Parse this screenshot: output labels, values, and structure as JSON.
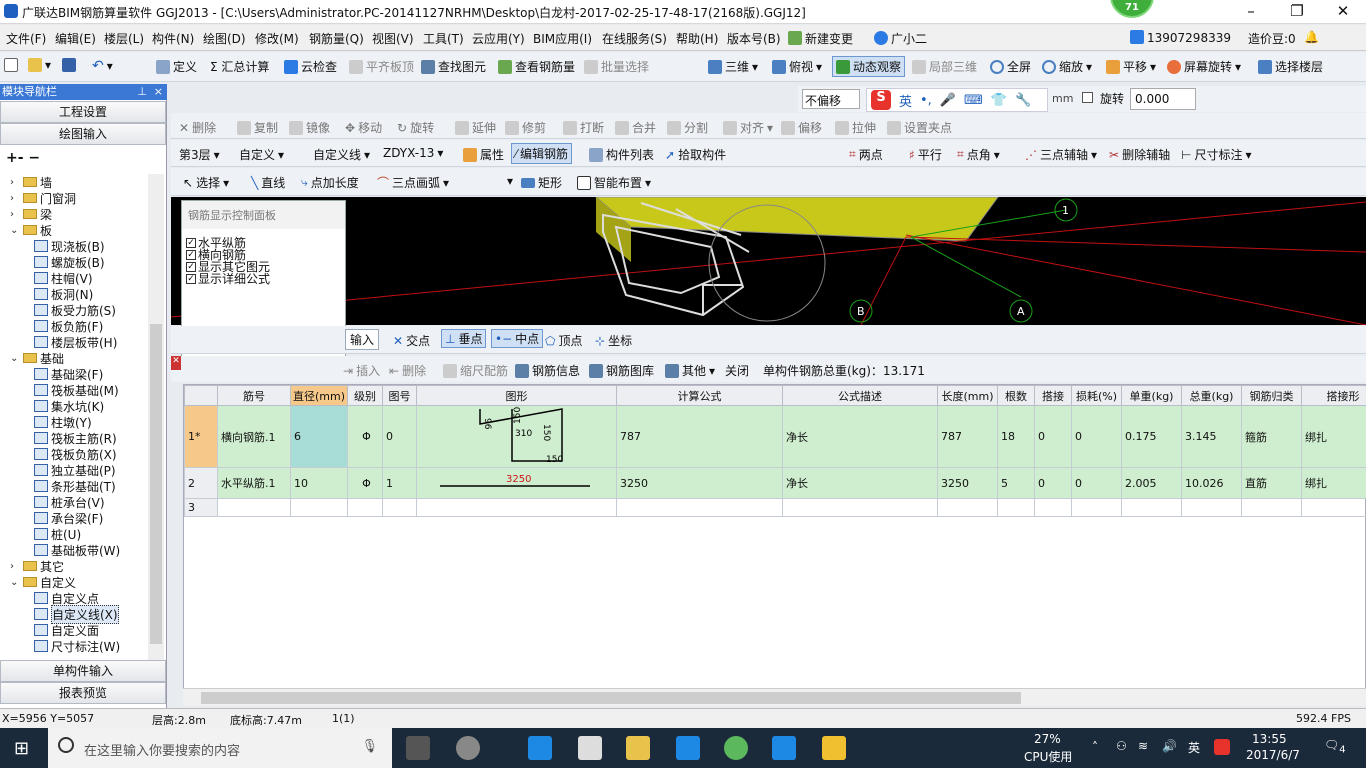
{
  "app": {
    "title": "广联达BIM钢筋算量软件 GGJ2013 - [C:\\Users\\Administrator.PC-20141127NRHM\\Desktop\\白龙村-2017-02-25-17-48-17(2168版).GGJ12]",
    "badge": "71"
  },
  "menu": [
    "文件(F)",
    "编辑(E)",
    "楼层(L)",
    "构件(N)",
    "绘图(D)",
    "修改(M)",
    "钢筋量(Q)",
    "视图(V)",
    "工具(T)",
    "云应用(Y)",
    "BIM应用(I)",
    "在线服务(S)",
    "帮助(H)",
    "版本号(B)",
    "新建变更",
    "广小二"
  ],
  "menu_right": {
    "phone": "13907298339",
    "price": "造价豆:0"
  },
  "toolbar1": [
    "定义",
    "Σ 汇总计算",
    "云检查",
    "平齐板顶",
    "查找图元",
    "查看钢筋量",
    "批量选择",
    "三维",
    "俯视",
    "动态观察",
    "局部三维",
    "全屏",
    "缩放",
    "平移",
    "屏幕旋转",
    "选择楼层"
  ],
  "offset": {
    "mode": "不偏移",
    "unit": "mm",
    "rotate_label": "旋转",
    "rotate_value": "0.000"
  },
  "toolbar2": [
    "删除",
    "复制",
    "镜像",
    "移动",
    "旋转",
    "延伸",
    "修剪",
    "打断",
    "合并",
    "分割",
    "对齐",
    "偏移",
    "拉伸",
    "设置夹点"
  ],
  "toolbar3": {
    "floor": "第3层",
    "type": "自定义",
    "sub": "自定义线",
    "code": "ZDYX-13",
    "items": [
      "属性",
      "编辑钢筋",
      "构件列表",
      "拾取构件",
      "两点",
      "平行",
      "点角",
      "三点辅轴",
      "删除辅轴",
      "尺寸标注"
    ]
  },
  "toolbar4": [
    "选择",
    "直线",
    "点加长度",
    "三点画弧",
    "矩形",
    "智能布置"
  ],
  "nav": {
    "title": "模块导航栏",
    "btn_settings": "工程设置",
    "btn_draw": "绘图输入",
    "btn_single": "单构件输入",
    "btn_report": "报表预览",
    "tree": [
      {
        "label": "墙",
        "level": 0,
        "kind": "folder",
        "state": "collapsed"
      },
      {
        "label": "门窗洞",
        "level": 0,
        "kind": "folder",
        "state": "collapsed"
      },
      {
        "label": "梁",
        "level": 0,
        "kind": "folder",
        "state": "collapsed"
      },
      {
        "label": "板",
        "level": 0,
        "kind": "folder",
        "state": "expanded"
      },
      {
        "label": "现浇板(B)",
        "level": 1
      },
      {
        "label": "螺旋板(B)",
        "level": 1
      },
      {
        "label": "柱帽(V)",
        "level": 1
      },
      {
        "label": "板洞(N)",
        "level": 1
      },
      {
        "label": "板受力筋(S)",
        "level": 1
      },
      {
        "label": "板负筋(F)",
        "level": 1
      },
      {
        "label": "楼层板带(H)",
        "level": 1
      },
      {
        "label": "基础",
        "level": 0,
        "kind": "folder",
        "state": "expanded"
      },
      {
        "label": "基础梁(F)",
        "level": 1
      },
      {
        "label": "筏板基础(M)",
        "level": 1
      },
      {
        "label": "集水坑(K)",
        "level": 1
      },
      {
        "label": "柱墩(Y)",
        "level": 1
      },
      {
        "label": "筏板主筋(R)",
        "level": 1
      },
      {
        "label": "筏板负筋(X)",
        "level": 1
      },
      {
        "label": "独立基础(P)",
        "level": 1
      },
      {
        "label": "条形基础(T)",
        "level": 1
      },
      {
        "label": "桩承台(V)",
        "level": 1
      },
      {
        "label": "承台梁(F)",
        "level": 1
      },
      {
        "label": "桩(U)",
        "level": 1
      },
      {
        "label": "基础板带(W)",
        "level": 1
      },
      {
        "label": "其它",
        "level": 0,
        "kind": "folder",
        "state": "collapsed"
      },
      {
        "label": "自定义",
        "level": 0,
        "kind": "folder",
        "state": "expanded"
      },
      {
        "label": "自定义点",
        "level": 1
      },
      {
        "label": "自定义线(X)",
        "level": 1,
        "selected": true
      },
      {
        "label": "自定义面",
        "level": 1
      },
      {
        "label": "尺寸标注(W)",
        "level": 1
      }
    ]
  },
  "panel": {
    "title": "钢筋显示控制面板",
    "items": [
      "水平纵筋",
      "横向钢筋",
      "显示其它图元",
      "显示详细公式"
    ]
  },
  "snap": {
    "input": "输入",
    "items": [
      "交点",
      "垂点",
      "中点",
      "顶点",
      "坐标"
    ]
  },
  "gridbar": {
    "items": [
      "插入",
      "删除",
      "缩尺配筋",
      "钢筋信息",
      "钢筋图库",
      "其他",
      "关闭"
    ],
    "total": "单构件钢筋总重(kg)：13.171"
  },
  "table": {
    "headers": [
      "筋号",
      "直径(mm)",
      "级别",
      "图号",
      "图形",
      "计算公式",
      "公式描述",
      "长度(mm)",
      "根数",
      "搭接",
      "损耗(%)",
      "单重(kg)",
      "总重(kg)",
      "钢筋归类",
      "搭接形"
    ],
    "rows": [
      {
        "no": "1*",
        "name": "横向钢筋.1",
        "dia": "6",
        "grade": "Φ",
        "fig": "0",
        "formula": "787",
        "desc": "净长",
        "len": "787",
        "count": "18",
        "lap": "0",
        "loss": "0",
        "unit_w": "0.175",
        "total_w": "3.145",
        "cat": "箍筋",
        "laptype": "绑扎",
        "shape": [
          "96",
          "150",
          "310",
          "150",
          "150"
        ]
      },
      {
        "no": "2",
        "name": "水平纵筋.1",
        "dia": "10",
        "grade": "Φ",
        "fig": "1",
        "formula": "3250",
        "desc": "净长",
        "len": "3250",
        "count": "5",
        "lap": "0",
        "loss": "0",
        "unit_w": "2.005",
        "total_w": "10.026",
        "cat": "直筋",
        "laptype": "绑扎",
        "shape": [
          "3250"
        ]
      },
      {
        "no": "3",
        "name": "",
        "dia": "",
        "grade": "",
        "fig": "",
        "formula": "",
        "desc": "",
        "len": "",
        "count": "",
        "lap": "",
        "loss": "",
        "unit_w": "",
        "total_w": "",
        "cat": "",
        "laptype": ""
      }
    ]
  },
  "canvas": {
    "axis_labels": [
      "1",
      "B",
      "A"
    ]
  },
  "status": {
    "coords": "X=5956 Y=5057",
    "floor_h": "层高:2.8m",
    "base_h": "底标高:7.47m",
    "count": "1(1)",
    "fps": "592.4 FPS"
  },
  "taskbar": {
    "search": "在这里输入你要搜索的内容",
    "cpu": "27%",
    "cpu_label": "CPU使用",
    "ime": "英",
    "time": "13:55",
    "date": "2017/6/7",
    "notif": "4"
  }
}
